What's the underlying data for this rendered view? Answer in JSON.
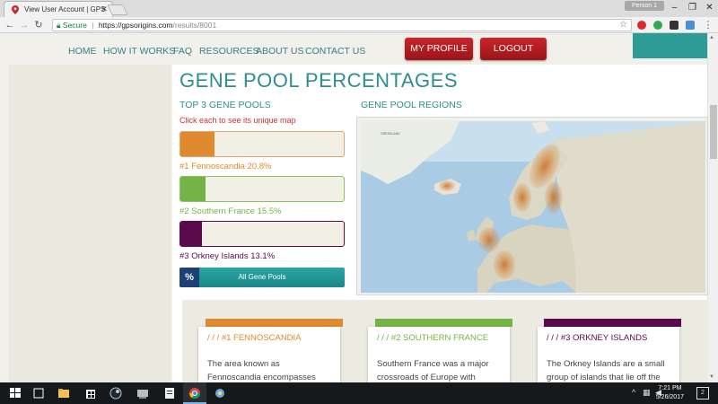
{
  "browser": {
    "tab_title": "View User Account | GPS",
    "profile_label": "Person 1",
    "secure_label": "Secure",
    "url_host": "https://gpsorigins.com",
    "url_path": "/results/8001"
  },
  "nav": {
    "items": [
      "HOME",
      "HOW IT WORKS",
      "FAQ",
      "RESOURCES",
      "ABOUT US",
      "CONTACT US"
    ],
    "my_profile": "MY PROFILE",
    "logout": "LOGOUT"
  },
  "main": {
    "title": "GENE POOL PERCENTAGES",
    "top_pools_heading": "TOP 3 GENE POOLS",
    "hint": "Click each to see its unique map",
    "regions_heading": "GENE POOL REGIONS",
    "pools": [
      {
        "label": "#1 Fennoscandia 20.8%",
        "percent": 20.8,
        "color": "#e08a2f",
        "border": "#e0a56a"
      },
      {
        "label": "#2 Southern France 15.5%",
        "percent": 15.5,
        "color": "#74b446",
        "border": "#8cc063"
      },
      {
        "label": "#3 Orkney Islands 13.1%",
        "percent": 13.1,
        "color": "#5c0a4e",
        "border": "#5c0a4e"
      }
    ],
    "all_pools_icon": "%",
    "all_pools_label": "All Gene Pools",
    "map_label_greenland": "GREENLAND"
  },
  "cards": [
    {
      "title": "/ / / #1 FENNOSCANDIA",
      "text": "The area known as Fennoscandia encompasses",
      "color": "#e08a2f"
    },
    {
      "title": "/ / / #2 SOUTHERN FRANCE",
      "text": "Southern France was a major crossroads of Europe with",
      "color": "#74b446"
    },
    {
      "title": "/ / / #3 ORKNEY ISLANDS",
      "text": "The Orkney Islands are a small group of islands that lie off the",
      "color": "#5c0a4e"
    }
  ],
  "taskbar": {
    "time": "7:21 PM",
    "date": "5/26/2017",
    "notifications": "2"
  }
}
